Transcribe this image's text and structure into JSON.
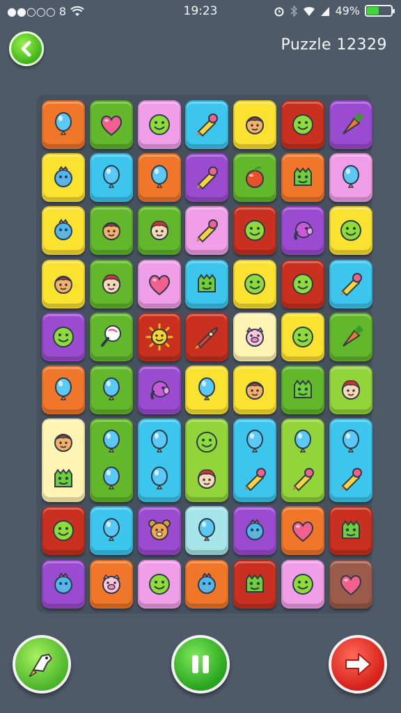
{
  "status_bar": {
    "carrier": "●●○○○ 8",
    "time": "19:23",
    "battery_text": "49%",
    "battery_level": 0.49
  },
  "header": {
    "back_icon": "chevron-left-icon",
    "title": "Puzzle 12329"
  },
  "colors": {
    "background": "#4f5a68",
    "orange": "#f0772a",
    "green": "#62b82a",
    "pink": "#f09ee8",
    "cyan": "#3cc6ee",
    "yellow": "#fbe230",
    "red": "#c9301f",
    "purple": "#9b4bd0",
    "lime": "#92d43a",
    "cream": "#fff4b3",
    "teal": "#a6e6ea",
    "brown": "#9b5b4a"
  },
  "board": {
    "rows": [
      [
        {
          "color": "orange",
          "icons": [
            "balloon-icon"
          ]
        },
        {
          "color": "green",
          "icons": [
            "heart-icon"
          ]
        },
        {
          "color": "pink",
          "icons": [
            "smiley-face-icon"
          ]
        },
        {
          "color": "cyan",
          "icons": [
            "ice-cream-icon"
          ]
        },
        {
          "color": "yellow",
          "icons": [
            "girl-face-icon"
          ]
        },
        {
          "color": "red",
          "icons": [
            "smiley-face-icon"
          ]
        },
        {
          "color": "purple",
          "icons": [
            "carrot-icon"
          ]
        }
      ],
      [
        {
          "color": "yellow",
          "icons": [
            "bird-icon"
          ]
        },
        {
          "color": "cyan",
          "icons": [
            "balloon-icon"
          ]
        },
        {
          "color": "orange",
          "icons": [
            "balloon-icon"
          ]
        },
        {
          "color": "purple",
          "icons": [
            "ice-cream-icon"
          ]
        },
        {
          "color": "green",
          "icons": [
            "fruit-icon"
          ]
        },
        {
          "color": "orange",
          "icons": [
            "monster-face-icon"
          ]
        },
        {
          "color": "pink",
          "icons": [
            "balloon-icon"
          ]
        }
      ],
      [
        {
          "color": "yellow",
          "icons": [
            "bird-icon"
          ]
        },
        {
          "color": "green",
          "icons": [
            "girl-face-icon"
          ]
        },
        {
          "color": "green",
          "icons": [
            "boy-face-icon"
          ]
        },
        {
          "color": "pink",
          "icons": [
            "ice-cream-icon"
          ]
        },
        {
          "color": "red",
          "icons": [
            "smiley-face-icon"
          ]
        },
        {
          "color": "purple",
          "icons": [
            "elephant-icon"
          ]
        },
        {
          "color": "yellow",
          "icons": [
            "smiley-face-icon"
          ]
        }
      ],
      [
        {
          "color": "yellow",
          "icons": [
            "girl-face-icon"
          ]
        },
        {
          "color": "green",
          "icons": [
            "boy-face-icon"
          ]
        },
        {
          "color": "pink",
          "icons": [
            "heart-icon"
          ]
        },
        {
          "color": "cyan",
          "icons": [
            "monster-face-icon"
          ]
        },
        {
          "color": "yellow",
          "icons": [
            "smiley-face-icon"
          ]
        },
        {
          "color": "red",
          "icons": [
            "smiley-face-icon"
          ]
        },
        {
          "color": "cyan",
          "icons": [
            "ice-cream-icon"
          ]
        }
      ],
      [
        {
          "color": "purple",
          "icons": [
            "smiley-face-icon"
          ]
        },
        {
          "color": "green",
          "icons": [
            "lollipop-icon"
          ]
        },
        {
          "color": "red",
          "icons": [
            "sun-face-icon"
          ]
        },
        {
          "color": "red",
          "icons": [
            "rocket-icon"
          ]
        },
        {
          "color": "cream",
          "icons": [
            "pig-face-icon"
          ]
        },
        {
          "color": "yellow",
          "icons": [
            "smiley-face-icon"
          ]
        },
        {
          "color": "green",
          "icons": [
            "carrot-icon"
          ]
        }
      ],
      [
        {
          "color": "orange",
          "icons": [
            "balloon-icon"
          ]
        },
        {
          "color": "green",
          "icons": [
            "balloon-icon"
          ]
        },
        {
          "color": "purple",
          "icons": [
            "elephant-icon"
          ]
        },
        {
          "color": "yellow",
          "icons": [
            "balloon-icon"
          ]
        },
        {
          "color": "yellow",
          "icons": [
            "girl-face-icon"
          ]
        },
        {
          "color": "green",
          "icons": [
            "monster-face-icon"
          ]
        },
        {
          "color": "lime",
          "icons": [
            "boy-face-icon"
          ]
        }
      ],
      [
        {
          "color": "cream",
          "icons": [
            "girl-face-icon",
            "monster-face-icon"
          ]
        },
        {
          "color": "green",
          "icons": [
            "balloon-icon",
            "balloon-icon"
          ]
        },
        {
          "color": "cyan",
          "icons": [
            "balloon-icon",
            "balloon-icon"
          ]
        },
        {
          "color": "lime",
          "icons": [
            "smiley-face-icon",
            "boy-face-icon"
          ]
        },
        {
          "color": "cyan",
          "icons": [
            "balloon-icon",
            "ice-cream-icon"
          ]
        },
        {
          "color": "lime",
          "icons": [
            "balloon-icon",
            "ice-cream-icon"
          ]
        },
        {
          "color": "cyan",
          "icons": [
            "balloon-icon",
            "ice-cream-icon"
          ]
        }
      ],
      [
        {
          "color": "red",
          "icons": [
            "smiley-face-icon"
          ]
        },
        {
          "color": "cyan",
          "icons": [
            "balloon-icon"
          ]
        },
        {
          "color": "purple",
          "icons": [
            "bear-icon"
          ]
        },
        {
          "color": "teal",
          "icons": [
            "balloon-icon"
          ]
        },
        {
          "color": "purple",
          "icons": [
            "bird-icon"
          ]
        },
        {
          "color": "orange",
          "icons": [
            "heart-icon"
          ]
        },
        {
          "color": "red",
          "icons": [
            "monster-face-icon"
          ]
        }
      ],
      [
        {
          "color": "purple",
          "icons": [
            "bird-icon"
          ]
        },
        {
          "color": "orange",
          "icons": [
            "pig-face-icon"
          ]
        },
        {
          "color": "pink",
          "icons": [
            "smiley-face-icon"
          ]
        },
        {
          "color": "orange",
          "icons": [
            "bird-icon"
          ]
        },
        {
          "color": "red",
          "icons": [
            "monster-face-icon"
          ]
        },
        {
          "color": "pink",
          "icons": [
            "smiley-face-icon"
          ]
        },
        {
          "color": "brown",
          "icons": [
            "heart-icon"
          ]
        }
      ]
    ]
  },
  "controls": {
    "hint_icon": "bird-hint-icon",
    "pause_icon": "pause-icon",
    "next_icon": "arrow-right-icon"
  }
}
